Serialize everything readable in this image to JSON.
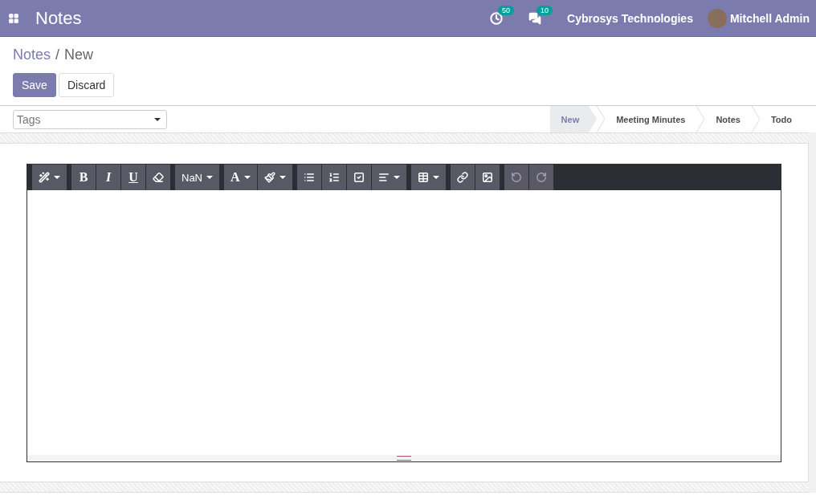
{
  "navbar": {
    "app_title": "Notes",
    "activity_count": "50",
    "messages_count": "10",
    "company": "Cybrosys Technologies",
    "user": "Mitchell Admin"
  },
  "breadcrumb": [
    {
      "label": "Notes",
      "selected": false
    },
    {
      "label": "New",
      "selected": true
    }
  ],
  "breadcrumb_separator": "/",
  "actions": [
    {
      "label": "Save",
      "kind": "primary"
    },
    {
      "label": "Discard",
      "kind": "secondary"
    }
  ],
  "tags_field": {
    "placeholder": "Tags"
  },
  "stages": [
    {
      "label": "New",
      "selected": true
    },
    {
      "label": "Meeting Minutes",
      "selected": false
    },
    {
      "label": "Notes",
      "selected": false
    },
    {
      "label": "Todo",
      "selected": false
    }
  ],
  "toolbar": [
    [
      {
        "kind": "wand",
        "dropdown": true
      }
    ],
    [
      {
        "kind": "bold",
        "text": "B"
      },
      {
        "kind": "italic",
        "text": "I"
      },
      {
        "kind": "underline",
        "text": "U"
      },
      {
        "kind": "eraser"
      }
    ],
    [
      {
        "kind": "size",
        "text": "NaN",
        "dropdown": true
      }
    ],
    [
      {
        "kind": "font-color",
        "text": "A",
        "dropdown": true
      },
      {
        "kind": "brush",
        "dropdown": true
      }
    ],
    [
      {
        "kind": "bullets"
      },
      {
        "kind": "numbers"
      },
      {
        "kind": "checklist"
      },
      {
        "kind": "align",
        "dropdown": true
      }
    ],
    [
      {
        "kind": "table",
        "dropdown": true
      }
    ],
    [
      {
        "kind": "link"
      },
      {
        "kind": "image"
      }
    ],
    [
      {
        "kind": "undo",
        "disabled": true
      },
      {
        "kind": "redo",
        "disabled": true
      }
    ]
  ]
}
